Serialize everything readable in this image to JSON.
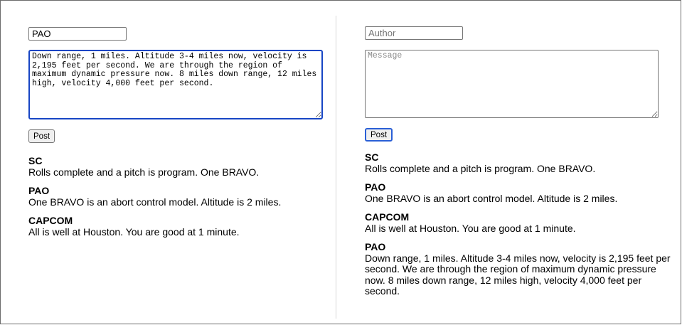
{
  "left": {
    "author_value": "PAO",
    "message_value": "Down range, 1 miles. Altitude 3-4 miles now, velocity is 2,195 feet per second. We are through the region of maximum dynamic pressure now. 8 miles down range, 12 miles high, velocity 4,000 feet per second.",
    "post_label": "Post",
    "messages": [
      {
        "author": "SC",
        "text": "Rolls complete and a pitch is program. One BRAVO."
      },
      {
        "author": "PAO",
        "text": "One BRAVO is an abort control model. Altitude is 2 miles."
      },
      {
        "author": "CAPCOM",
        "text": "All is well at Houston. You are good at 1 minute."
      }
    ]
  },
  "right": {
    "author_placeholder": "Author",
    "message_placeholder": "Message",
    "post_label": "Post",
    "messages": [
      {
        "author": "SC",
        "text": "Rolls complete and a pitch is program. One BRAVO."
      },
      {
        "author": "PAO",
        "text": "One BRAVO is an abort control model. Altitude is 2 miles."
      },
      {
        "author": "CAPCOM",
        "text": "All is well at Houston. You are good at 1 minute."
      },
      {
        "author": "PAO",
        "text": "Down range, 1 miles. Altitude 3-4 miles now, velocity is 2,195 feet per second. We are through the region of maximum dynamic pressure now. 8 miles down range, 12 miles high, velocity 4,000 feet per second."
      }
    ]
  }
}
